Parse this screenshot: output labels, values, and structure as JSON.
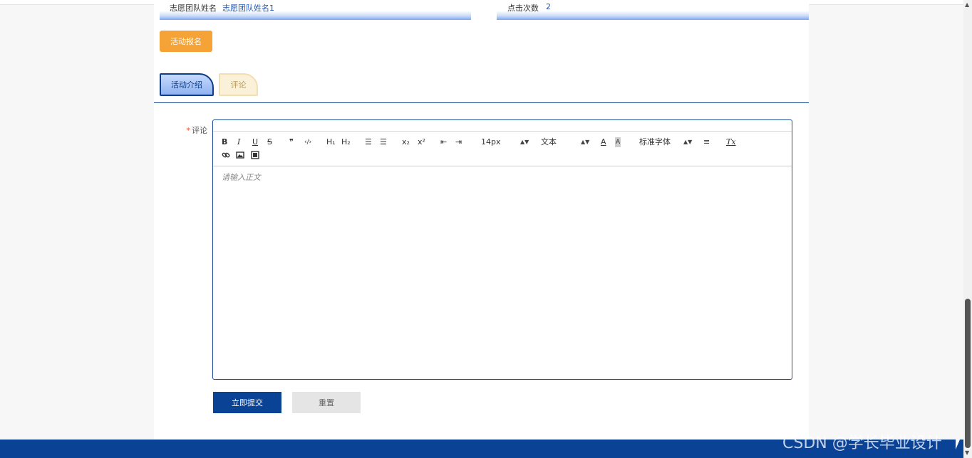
{
  "info": {
    "team_label": "志愿团队姓名",
    "team_value": "志愿团队姓名1",
    "clicks_label": "点击次数",
    "clicks_value": "2"
  },
  "actions": {
    "signup_label": "活动报名"
  },
  "tabs": [
    {
      "label": "活动介绍",
      "active": true
    },
    {
      "label": "评论",
      "active": false
    }
  ],
  "form": {
    "required_mark": "*",
    "comment_label": "评论",
    "placeholder": "请输入正文",
    "submit_label": "立即提交",
    "reset_label": "重置"
  },
  "toolbar": {
    "bold": "B",
    "italic": "I",
    "underline": "U",
    "strike": "S",
    "quote": "❞",
    "code": "‹/›",
    "h1": "H₁",
    "h2": "H₂",
    "ordered_list": "☰",
    "bullet_list": "☰",
    "subscript": "x₂",
    "superscript": "x²",
    "outdent": "⇤",
    "indent": "⇥",
    "size_value": "14px",
    "header_value": "文本",
    "font_value": "标准字体",
    "align": "≡",
    "clean": "Tx",
    "icons": [
      "bold-icon",
      "italic-icon",
      "underline-icon",
      "strike-icon",
      "quote-icon",
      "code-icon",
      "link-icon",
      "image-icon",
      "video-icon",
      "color-icon",
      "background-icon",
      "align-icon",
      "clean-icon"
    ]
  },
  "watermark": "CSDN @学长毕业设计",
  "colors": {
    "primary": "#0a4296",
    "accent_orange": "#f5a236",
    "tab_inactive_bg": "#fbf1d8",
    "required": "#e84c3d"
  }
}
